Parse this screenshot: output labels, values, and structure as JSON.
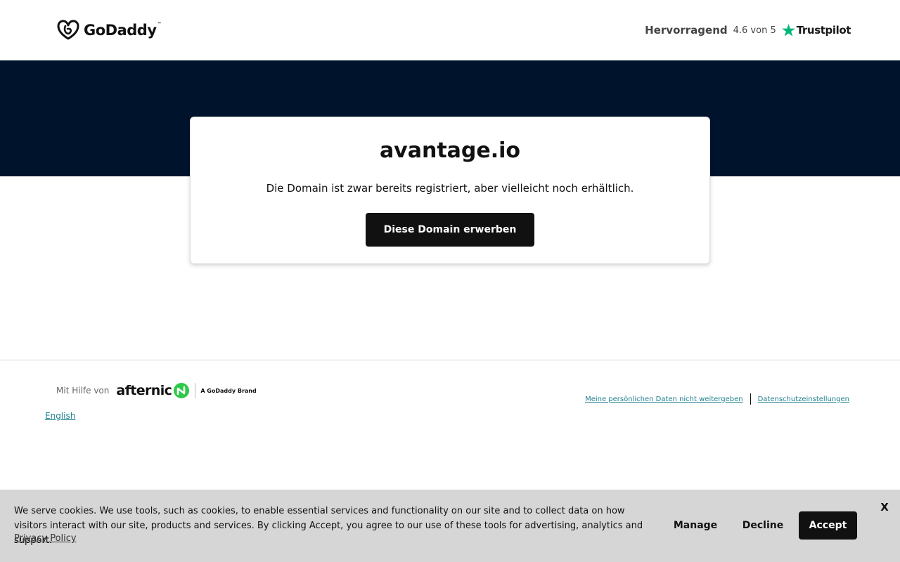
{
  "header": {
    "logo_text": "GoDaddy",
    "logo_tm": "™",
    "rating_word": "Hervorragend",
    "rating_score": "4.6 von 5",
    "trustpilot_label": "Trustpilot"
  },
  "card": {
    "domain": "avantage.io",
    "message": "Die Domain ist zwar bereits registriert, aber vielleicht noch erhältlich.",
    "buy_label": "Diese Domain erwerben"
  },
  "footer": {
    "powered_by": "Mit Hilfe von",
    "afternic_logo_text": "afternic",
    "brand_tag": "A GoDaddy Brand",
    "language_link": "English",
    "links": [
      "Meine persönlichen Daten nicht weitergeben",
      "Datenschutzeinstellungen"
    ]
  },
  "cookie_banner": {
    "text": "We serve cookies. We use tools, such as cookies, to enable essential services and functionality on our site and to collect data on how visitors interact with our site, products and services. By clicking Accept, you agree to our use of these tools for advertising, analytics and support.",
    "privacy_link": "Privacy Policy",
    "manage_label": "Manage",
    "decline_label": "Decline",
    "accept_label": "Accept",
    "close_label": "X"
  },
  "colors": {
    "hero_background": "#00132c",
    "button_background": "#111111",
    "trustpilot_green": "#00b67a",
    "afternic_green": "#2ec84a",
    "link_color": "#1e7f8f",
    "cookie_background": "#d6d6d6"
  },
  "icons": {
    "logo": "godaddy-logo-icon",
    "trustpilot": "trustpilot-star-icon",
    "afternic": "afternic-mark-icon"
  }
}
